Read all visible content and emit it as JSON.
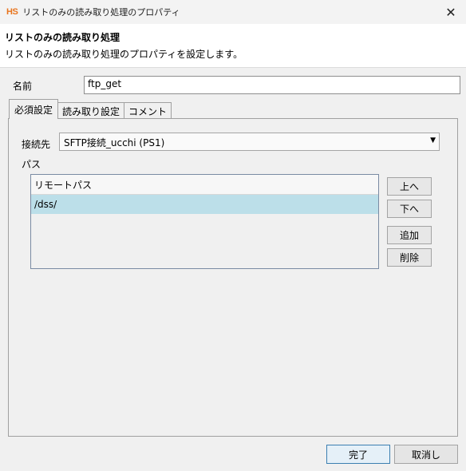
{
  "window": {
    "logo": "HS",
    "title": "リストのみの読み取り処理のプロパティ",
    "close_glyph": "✕"
  },
  "header": {
    "title": "リストのみの読み取り処理",
    "description": "リストのみの読み取り処理のプロパティを設定します。"
  },
  "name_field": {
    "label": "名前",
    "value": "ftp_get"
  },
  "tabs": [
    {
      "label": "必須設定",
      "active": true
    },
    {
      "label": "読み取り設定",
      "active": false
    },
    {
      "label": "コメント",
      "active": false
    }
  ],
  "destination": {
    "label": "接続先",
    "value": "SFTP接続_ucchi (PS1)",
    "arrow_glyph": "▼"
  },
  "path_section": {
    "label": "パス",
    "column_header": "リモートパス",
    "rows": [
      "/dss/"
    ],
    "selected_row_color": "#bcdfe9"
  },
  "side_buttons": {
    "up": "上へ",
    "down": "下へ",
    "add": "追加",
    "delete": "削除"
  },
  "footer": {
    "finish": "完了",
    "cancel": "取消し"
  },
  "colors": {
    "logo": "#e8741d",
    "default_button_border": "#3c7fb1"
  }
}
